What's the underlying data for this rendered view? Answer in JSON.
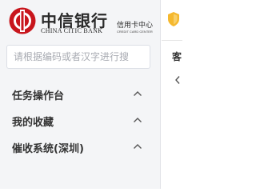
{
  "brand": {
    "name_cn": "中信银行",
    "name_en": "CHINA CITIC BANK",
    "subtitle_cn": "信用卡中心",
    "subtitle_en": "CREDIT CARD CENTER",
    "accent_color": "#c8161d"
  },
  "search": {
    "placeholder": "请根据编码或者汉字进行搜"
  },
  "menu": [
    {
      "label": "任务操作台",
      "icon": "chevron-up-icon"
    },
    {
      "label": "我的收藏",
      "icon": "chevron-up-icon"
    },
    {
      "label": "催收系统(深圳)",
      "icon": "chevron-up-icon"
    }
  ],
  "right_panel": {
    "label": "客",
    "shield_icon": "shield-icon",
    "shield_color": "#f5b82e",
    "back_icon": "chevron-left-icon"
  }
}
